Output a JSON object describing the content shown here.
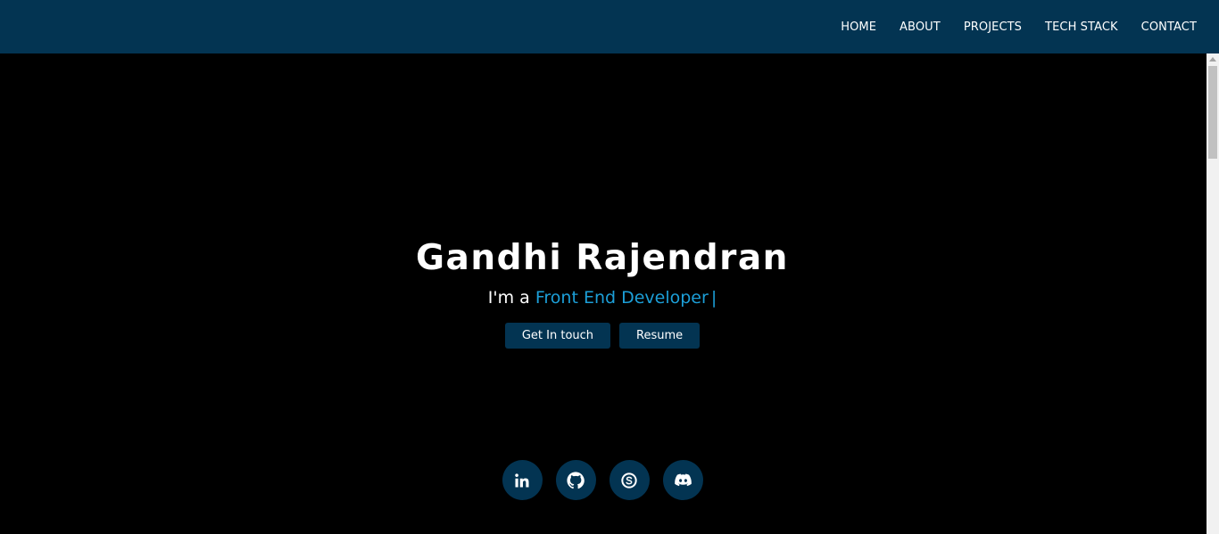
{
  "nav": {
    "items": [
      {
        "label": "HOME"
      },
      {
        "label": "ABOUT"
      },
      {
        "label": "PROJECTS"
      },
      {
        "label": "TECH STACK"
      },
      {
        "label": "CONTACT"
      }
    ]
  },
  "hero": {
    "name": "Gandhi Rajendran",
    "intro": "I'm a",
    "role": "Front End Developer",
    "cursor": "|"
  },
  "buttons": {
    "contact_label": "Get In touch",
    "resume_label": "Resume"
  },
  "social": [
    {
      "icon": "linkedin-icon"
    },
    {
      "icon": "github-icon"
    },
    {
      "icon": "skype-icon"
    },
    {
      "icon": "discord-icon"
    }
  ],
  "colors": {
    "nav_bg": "#033452",
    "page_bg": "#000000",
    "accent": "#1c9fd8",
    "button_bg": "#033452",
    "text": "#ffffff"
  }
}
